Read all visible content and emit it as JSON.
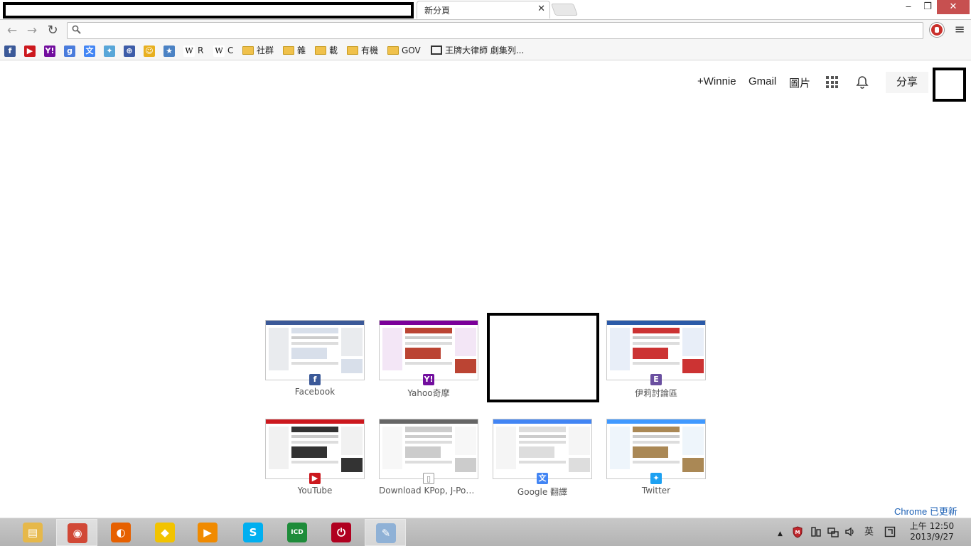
{
  "window": {
    "active_tab_title": "新分頁",
    "tab_close_glyph": "✕",
    "min_glyph": "‒",
    "restore_glyph": "❐",
    "close_glyph": "✕"
  },
  "toolbar": {
    "back_glyph": "←",
    "forward_glyph": "→",
    "reload_glyph": "↻",
    "omnibox_value": "",
    "menu_glyph": "≡"
  },
  "bookmarks": [
    {
      "label": "",
      "icon": "facebook-icon",
      "glyph": "f",
      "color": "#3b5998"
    },
    {
      "label": "",
      "icon": "youtube-icon",
      "glyph": "▶",
      "color": "#cc181e"
    },
    {
      "label": "",
      "icon": "yahoo-icon",
      "glyph": "Y!",
      "color": "#720e9e"
    },
    {
      "label": "",
      "icon": "google-icon",
      "glyph": "g",
      "color": "#4a7cdc"
    },
    {
      "label": "",
      "icon": "translate-icon",
      "glyph": "文",
      "color": "#4285f4"
    },
    {
      "label": "",
      "icon": "bird-icon",
      "glyph": "✦",
      "color": "#58a6d8"
    },
    {
      "label": "",
      "icon": "globe-icon",
      "glyph": "⊕",
      "color": "#3d5ca8"
    },
    {
      "label": "",
      "icon": "smiley-icon",
      "glyph": "☺",
      "color": "#e8b020"
    },
    {
      "label": "",
      "icon": "star-icon",
      "glyph": "★",
      "color": "#4b82c4"
    },
    {
      "label": "R",
      "icon": "wikipedia-icon",
      "glyph": "W",
      "color": "#ffffff"
    },
    {
      "label": "C",
      "icon": "wikipedia-icon",
      "glyph": "W",
      "color": "#ffffff"
    },
    {
      "label": "社群",
      "icon": "folder-icon"
    },
    {
      "label": "雜",
      "icon": "folder-icon"
    },
    {
      "label": "載",
      "icon": "folder-icon"
    },
    {
      "label": "有機",
      "icon": "folder-icon"
    },
    {
      "label": "GOV",
      "icon": "folder-icon"
    },
    {
      "label": "王牌大律師 劇集列...",
      "icon": "monitor-icon"
    }
  ],
  "google_bar": {
    "plus_user": "+Winnie",
    "gmail": "Gmail",
    "images": "圖片",
    "share": "分享",
    "bell_glyph": "🔔"
  },
  "tiles": [
    {
      "title": "Facebook",
      "fav_glyph": "f",
      "fav_color": "#3b5998"
    },
    {
      "title": "Yahoo奇摩",
      "fav_glyph": "Y!",
      "fav_color": "#720e9e"
    },
    {
      "title": "",
      "redacted": true
    },
    {
      "title": "伊莉討論區",
      "fav_glyph": "E",
      "fav_color": "#6a4fa0"
    },
    {
      "title": "YouTube",
      "fav_glyph": "▶",
      "fav_color": "#cc181e"
    },
    {
      "title": "Download KPop, J-Pop...",
      "fav_glyph": "▯",
      "fav_color": "#ffffff"
    },
    {
      "title": "Google 翻譯",
      "fav_glyph": "文",
      "fav_color": "#4285f4"
    },
    {
      "title": "Twitter",
      "fav_glyph": "✦",
      "fav_color": "#1da1f2"
    }
  ],
  "chrome_updated": "Chrome 已更新",
  "taskbar": {
    "apps": [
      {
        "icon": "file-explorer-icon",
        "glyph": "▤",
        "color": "#e6b84a"
      },
      {
        "icon": "chrome-icon",
        "glyph": "◉",
        "color": "#d14836"
      },
      {
        "icon": "firefox-icon",
        "glyph": "◐",
        "color": "#e66000"
      },
      {
        "icon": "kakao-icon",
        "glyph": "◆",
        "color": "#f2c300"
      },
      {
        "icon": "media-player-icon",
        "glyph": "▶",
        "color": "#f08a00"
      },
      {
        "icon": "skype-icon",
        "glyph": "S",
        "color": "#00aff0"
      },
      {
        "icon": "icd-icon",
        "glyph": "ICD",
        "color": "#1e8c3a"
      },
      {
        "icon": "power-icon",
        "glyph": "⏻",
        "color": "#b00020"
      },
      {
        "icon": "paint-icon",
        "glyph": "✎",
        "color": "#8fb1d6"
      }
    ],
    "tray": {
      "up_arrow": "▲",
      "ime": "英",
      "clock_time": "上午 12:50",
      "clock_date": "2013/9/27"
    }
  }
}
